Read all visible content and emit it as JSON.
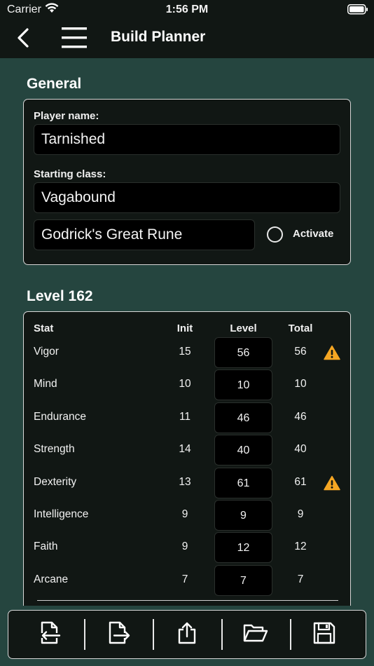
{
  "status_bar": {
    "carrier": "Carrier",
    "time": "1:56 PM"
  },
  "nav": {
    "title": "Build Planner",
    "back_icon": "chevron-left-icon",
    "menu_icon": "hamburger-menu-icon"
  },
  "general": {
    "section_title": "General",
    "player_name_label": "Player name:",
    "player_name_value": "Tarnished",
    "starting_class_label": "Starting class:",
    "starting_class_value": "Vagabound",
    "great_rune_value": "Godrick's Great Rune",
    "activate_label": "Activate",
    "activate_checked": false
  },
  "level": {
    "section_title": "Level 162",
    "headers": {
      "stat": "Stat",
      "init": "Init",
      "level": "Level",
      "total": "Total"
    },
    "rows": [
      {
        "name": "Vigor",
        "init": "15",
        "level": "56",
        "total": "56",
        "warning": true
      },
      {
        "name": "Mind",
        "init": "10",
        "level": "10",
        "total": "10",
        "warning": false
      },
      {
        "name": "Endurance",
        "init": "11",
        "level": "46",
        "total": "46",
        "warning": false
      },
      {
        "name": "Strength",
        "init": "14",
        "level": "40",
        "total": "40",
        "warning": false
      },
      {
        "name": "Dexterity",
        "init": "13",
        "level": "61",
        "total": "61",
        "warning": true
      },
      {
        "name": "Intelligence",
        "init": "9",
        "level": "9",
        "total": "9",
        "warning": false
      },
      {
        "name": "Faith",
        "init": "9",
        "level": "12",
        "total": "12",
        "warning": false
      },
      {
        "name": "Arcane",
        "init": "7",
        "level": "7",
        "total": "7",
        "warning": false
      }
    ]
  },
  "toolbar": {
    "items": [
      "import-file-icon",
      "export-file-icon",
      "share-icon",
      "open-folder-icon",
      "save-disk-icon"
    ]
  },
  "colors": {
    "background": "#25453f",
    "bar": "#111714",
    "card": "#111714",
    "field": "#000000",
    "warning": "#f5a623"
  }
}
